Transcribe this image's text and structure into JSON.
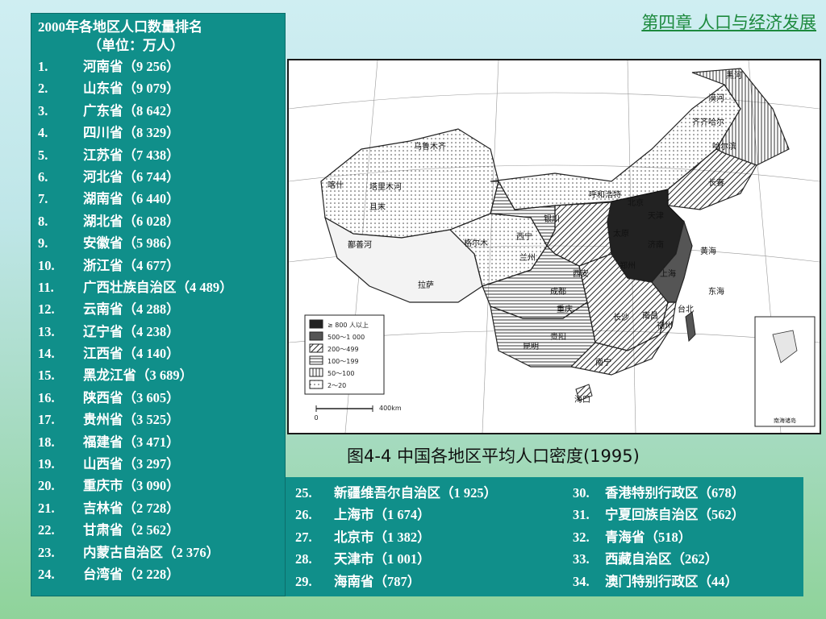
{
  "header": {
    "chapter": "第四章  人口与经济发展"
  },
  "ranking": {
    "title": "2000年各地区人口数量排名",
    "subtitle": "（单位：万人）",
    "items": [
      {
        "num": "1.",
        "name": "河南省",
        "val": "（9 256）"
      },
      {
        "num": "2.",
        "name": "山东省",
        "val": "（9 079）"
      },
      {
        "num": "3.",
        "name": "广东省",
        "val": "（8 642）"
      },
      {
        "num": "4.",
        "name": "四川省",
        "val": "（8 329）"
      },
      {
        "num": "5.",
        "name": "江苏省",
        "val": "（7 438）"
      },
      {
        "num": "6.",
        "name": "河北省",
        "val": "（6 744）"
      },
      {
        "num": "7.",
        "name": "湖南省",
        "val": "（6 440）"
      },
      {
        "num": "8.",
        "name": "湖北省",
        "val": "（6 028）"
      },
      {
        "num": "9.",
        "name": "安徽省",
        "val": "（5 986）"
      },
      {
        "num": "10.",
        "name": "浙江省",
        "val": "（4 677）"
      },
      {
        "num": "11.",
        "name": "广西壮族自治区",
        "val": "（4 489）"
      },
      {
        "num": "12.",
        "name": "云南省",
        "val": "（4 288）"
      },
      {
        "num": "13.",
        "name": "辽宁省",
        "val": "（4 238）"
      },
      {
        "num": "14.",
        "name": "江西省",
        "val": "（4 140）"
      },
      {
        "num": "15.",
        "name": "黑龙江省",
        "val": "（3 689）"
      },
      {
        "num": "16.",
        "name": "陕西省",
        "val": "（3 605）"
      },
      {
        "num": "17.",
        "name": "贵州省",
        "val": "（3 525）"
      },
      {
        "num": "18.",
        "name": "福建省",
        "val": "（3 471）"
      },
      {
        "num": "19.",
        "name": "山西省",
        "val": "（3 297）"
      },
      {
        "num": "20.",
        "name": "重庆市",
        "val": "（3 090）"
      },
      {
        "num": "21.",
        "name": "吉林省",
        "val": "（2 728）"
      },
      {
        "num": "22.",
        "name": "甘肃省",
        "val": "（2 562）"
      },
      {
        "num": "23.",
        "name": "内蒙古自治区",
        "val": "（2 376）"
      },
      {
        "num": "24.",
        "name": "台湾省",
        "val": "（2 228）"
      }
    ],
    "bottom_left": [
      {
        "num": "25.",
        "name": "新疆维吾尔自治区",
        "val": "（1 925）"
      },
      {
        "num": "26.",
        "name": "上海市",
        "val": "（1 674）"
      },
      {
        "num": "27.",
        "name": "北京市",
        "val": "（1 382）"
      },
      {
        "num": "28.",
        "name": "天津市",
        "val": "（1 001）"
      },
      {
        "num": "29.",
        "name": "海南省",
        "val": "（787）"
      }
    ],
    "bottom_right": [
      {
        "num": "30.",
        "name": "香港特别行政区",
        "val": "（678）"
      },
      {
        "num": "31.",
        "name": "宁夏回族自治区",
        "val": "（562）"
      },
      {
        "num": "32.",
        "name": "青海省",
        "val": "（518）"
      },
      {
        "num": "33.",
        "name": "西藏自治区",
        "val": "（262）"
      },
      {
        "num": "34.",
        "name": "澳门特别行政区",
        "val": "（44）"
      }
    ]
  },
  "map": {
    "caption": "图4-4  中国各地区平均人口密度(1995)",
    "legend": [
      {
        "label": "≥ 800 人以上",
        "fill": "#222222"
      },
      {
        "label": "500～1 000",
        "fill": "#555555"
      },
      {
        "label": "200～499",
        "fill": "#8a8a8a"
      },
      {
        "label": "100～199",
        "fill": "#b0b0b0"
      },
      {
        "label": "50～100",
        "fill": "#d0d0d0"
      },
      {
        "label": "2～20",
        "fill": "#eeeeee"
      }
    ],
    "scale_label": "400km",
    "scale_zero": "0",
    "inset_label": "南海诸岛",
    "city_labels": [
      "乌鲁木齐",
      "喀什",
      "且末",
      "鄯善河",
      "塔里木河",
      "拉萨",
      "格尔木",
      "西宁",
      "兰州",
      "银川",
      "呼和浩特",
      "北京",
      "天津",
      "太原",
      "济南",
      "郑州",
      "西安",
      "成都",
      "重庆",
      "贵阳",
      "昆明",
      "南宁",
      "长沙",
      "南昌",
      "福州",
      "上海",
      "台北",
      "海口",
      "长春",
      "哈尔滨",
      "齐齐哈尔",
      "黑河",
      "漠河",
      "黄海",
      "东海"
    ]
  }
}
